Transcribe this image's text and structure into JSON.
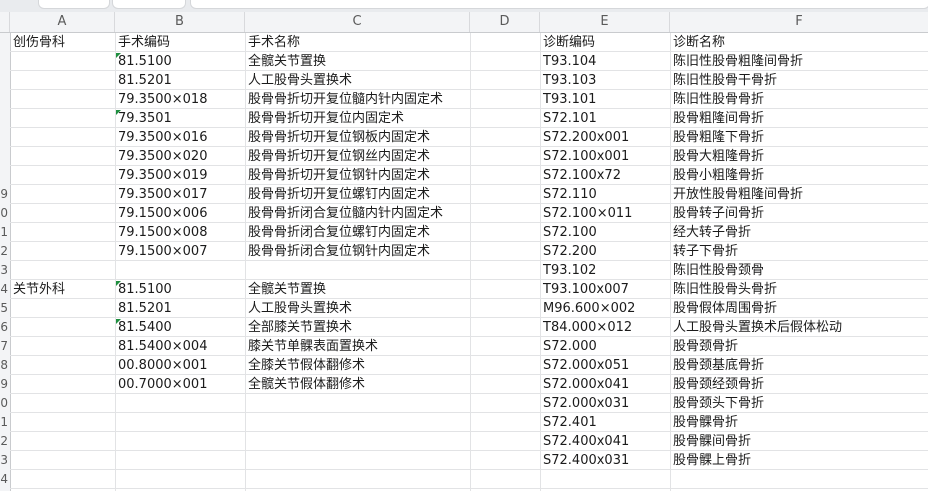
{
  "columns": [
    "A",
    "B",
    "C",
    "D",
    "E",
    "F"
  ],
  "rows": [
    {
      "num": "",
      "a": "创伤骨科",
      "b": "手术编码",
      "c": "手术名称",
      "e": "诊断编码",
      "f": "诊断名称",
      "flag": false
    },
    {
      "num": "",
      "a": "",
      "b": "81.5100",
      "c": "全髋关节置换",
      "e": "T93.104",
      "f": "陈旧性股骨粗隆间骨折",
      "flag": true
    },
    {
      "num": "",
      "a": "",
      "b": "81.5201",
      "c": "人工股骨头置换术",
      "e": "T93.103",
      "f": "陈旧性股骨干骨折",
      "flag": false
    },
    {
      "num": "",
      "a": "",
      "b": "79.3500×018",
      "c": "股骨骨折切开复位髓内针内固定术",
      "e": "T93.101",
      "f": "陈旧性股骨骨折",
      "flag": false
    },
    {
      "num": "",
      "a": "",
      "b": "79.3501",
      "c": "股骨骨折切开复位内固定术",
      "e": "S72.101",
      "f": "股骨粗隆间骨折",
      "flag": true
    },
    {
      "num": "",
      "a": "",
      "b": "79.3500×016",
      "c": "股骨骨折切开复位钢板内固定术",
      "e": "S72.200x001",
      "f": "股骨粗隆下骨折",
      "flag": false
    },
    {
      "num": "",
      "a": "",
      "b": "79.3500×020",
      "c": "股骨骨折切开复位钢丝内固定术",
      "e": "S72.100x001",
      "f": "股骨大粗隆骨折",
      "flag": false
    },
    {
      "num": "",
      "a": "",
      "b": "79.3500×019",
      "c": "股骨骨折切开复位钢针内固定术",
      "e": "S72.100x72",
      "f": "股骨小粗隆骨折",
      "flag": false
    },
    {
      "num": "9",
      "a": "",
      "b": "79.3500×017",
      "c": "股骨骨折切开复位螺钉内固定术",
      "e": "S72.110",
      "f": "开放性股骨粗隆间骨折",
      "flag": false
    },
    {
      "num": "0",
      "a": "",
      "b": "79.1500×006",
      "c": "股骨骨折闭合复位髓内针内固定术",
      "e": "S72.100×011",
      "f": "股骨转子间骨折",
      "flag": false
    },
    {
      "num": "1",
      "a": "",
      "b": "79.1500×008",
      "c": "股骨骨折闭合复位螺钉内固定术",
      "e": "S72.100",
      "f": "经大转子骨折",
      "flag": false
    },
    {
      "num": "2",
      "a": "",
      "b": "79.1500×007",
      "c": "股骨骨折闭合复位钢针内固定术",
      "e": "S72.200",
      "f": "转子下骨折",
      "flag": false
    },
    {
      "num": "3",
      "a": "",
      "b": "",
      "c": "",
      "e": "T93.102",
      "f": "陈旧性股骨颈骨",
      "flag": false
    },
    {
      "num": "4",
      "a": "关节外科",
      "b": "81.5100",
      "c": "全髋关节置换",
      "e": "T93.100x007",
      "f": "陈旧性股骨头骨折",
      "flag": true
    },
    {
      "num": "5",
      "a": "",
      "b": "81.5201",
      "c": "人工股骨头置换术",
      "e": "M96.600×002",
      "f": "股骨假体周围骨折",
      "flag": false
    },
    {
      "num": "6",
      "a": "",
      "b": "81.5400",
      "c": "全部膝关节置换术",
      "e": "T84.000×012",
      "f": "人工股骨头置换术后假体松动",
      "flag": true
    },
    {
      "num": "7",
      "a": "",
      "b": "81.5400×004",
      "c": "膝关节单髁表面置换术",
      "e": "S72.000",
      "f": "股骨颈骨折",
      "flag": false
    },
    {
      "num": "8",
      "a": "",
      "b": "00.8000×001",
      "c": "全膝关节假体翻修术",
      "e": "S72.000x051",
      "f": "股骨颈基底骨折",
      "flag": false
    },
    {
      "num": "9",
      "a": "",
      "b": "00.7000×001",
      "c": "全髋关节假体翻修术",
      "e": "S72.000x041",
      "f": "股骨颈经颈骨折",
      "flag": false
    },
    {
      "num": "0",
      "a": "",
      "b": "",
      "c": "",
      "e": "S72.000x031",
      "f": "股骨颈头下骨折",
      "flag": false
    },
    {
      "num": "1",
      "a": "",
      "b": "",
      "c": "",
      "e": "S72.401",
      "f": "股骨髁骨折",
      "flag": false
    },
    {
      "num": "2",
      "a": "",
      "b": "",
      "c": "",
      "e": "S72.400x041",
      "f": "股骨髁间骨折",
      "flag": false
    },
    {
      "num": "3",
      "a": "",
      "b": "",
      "c": "",
      "e": "S72.400x031",
      "f": "股骨髁上骨折",
      "flag": false
    },
    {
      "num": "4",
      "a": "",
      "b": "",
      "c": "",
      "e": "",
      "f": "",
      "flag": false
    }
  ]
}
